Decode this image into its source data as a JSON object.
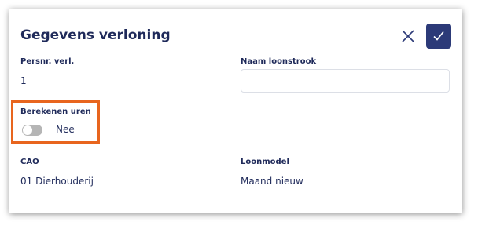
{
  "dialog": {
    "title": "Gegevens verloning",
    "close_icon": "close-icon",
    "confirm_icon": "check-icon",
    "accent_color": "#2c3a78",
    "highlight_color": "#e8651e"
  },
  "fields": {
    "persnr": {
      "label": "Persnr. verl.",
      "value": "1"
    },
    "naam_loonstrook": {
      "label": "Naam loonstrook",
      "value": "",
      "placeholder": ""
    },
    "berekenen_uren": {
      "label": "Berekenen uren",
      "toggle_state": "off",
      "toggle_text": "Nee"
    },
    "cao": {
      "label": "CAO",
      "value": "01 Dierhouderij"
    },
    "loonmodel": {
      "label": "Loonmodel",
      "value": "Maand nieuw"
    }
  }
}
